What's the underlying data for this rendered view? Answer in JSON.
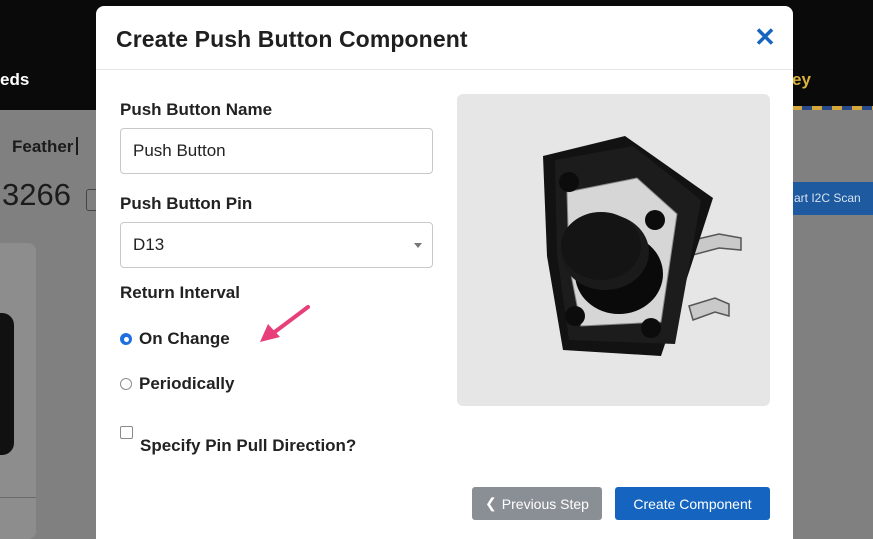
{
  "background": {
    "nav_left": "eds",
    "nav_right": "ey",
    "board_label": "Feather",
    "chip_label": "3266",
    "scan_button_label": "art I2C Scan"
  },
  "modal": {
    "title": "Create Push Button Component",
    "close_glyph": "✕",
    "name_label": "Push Button Name",
    "name_value": "Push Button",
    "pin_label": "Push Button Pin",
    "pin_selected": "D13",
    "interval_label": "Return Interval",
    "interval_options": [
      {
        "label": "On Change",
        "selected": true
      },
      {
        "label": "Periodically",
        "selected": false
      }
    ],
    "pull_direction_label": "Specify Pin Pull Direction?",
    "pull_direction_checked": false,
    "previous_button": "Previous Step",
    "create_button": "Create Component",
    "image_subject": "tactile-push-button-icon"
  },
  "colors": {
    "accent": "#1565c0",
    "arrow": "#e83e7a",
    "secondary_button": "#8a8f95"
  }
}
